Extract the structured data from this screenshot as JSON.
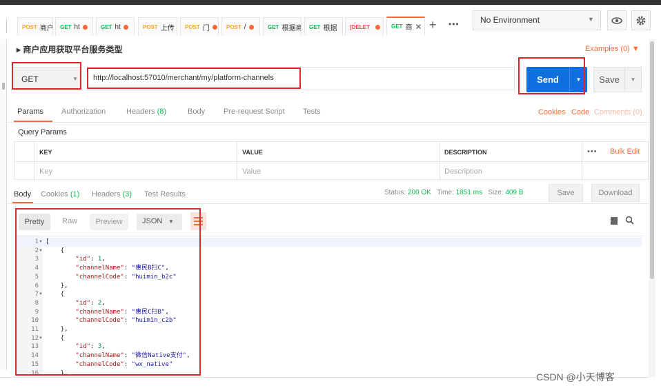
{
  "tabs": [
    {
      "method": "POST",
      "label": "商户",
      "dot": false
    },
    {
      "method": "GET",
      "label": "ht",
      "dot": true
    },
    {
      "method": "GET",
      "label": "ht",
      "dot": true
    },
    {
      "method": "POST",
      "label": "上传",
      "dot": false
    },
    {
      "method": "POST",
      "label": "门",
      "dot": true
    },
    {
      "method": "POST",
      "label": "/",
      "dot": true
    },
    {
      "method": "GET",
      "label": "根据商",
      "dot": false
    },
    {
      "method": "GET",
      "label": "根据",
      "dot": false
    },
    {
      "method": "[DELET",
      "label": "",
      "dot": true
    },
    {
      "method": "GET",
      "label": "商",
      "dot": false,
      "active": true
    }
  ],
  "tab_add": "+",
  "tab_more": "•••",
  "environment": {
    "selected": "No Environment",
    "caret": "▼",
    "eye_icon": "eye-icon",
    "gear_icon": "gear-icon"
  },
  "request": {
    "title": "▸ 商户应用获取平台服务类型",
    "examples": "Examples (0)  ▼",
    "method": "GET",
    "url": "http://localhost:57010/merchant/my/platform-channels",
    "send_label": "Send",
    "save_label": "Save"
  },
  "request_tabs": {
    "params": "Params",
    "authorization": "Authorization",
    "headers": "Headers",
    "headers_count": "(8)",
    "body": "Body",
    "prerequest": "Pre-request Script",
    "tests": "Tests",
    "cookies": "Cookies",
    "code": "Code",
    "comments": "Comments (0)"
  },
  "query_params": {
    "title": "Query Params",
    "headers": {
      "key": "KEY",
      "value": "VALUE",
      "description": "DESCRIPTION"
    },
    "placeholders": {
      "key": "Key",
      "value": "Value",
      "description": "Description"
    },
    "more": "•••",
    "bulk_edit": "Bulk Edit"
  },
  "response_tabs": {
    "body": "Body",
    "cookies": "Cookies",
    "cookies_count": "(1)",
    "headers": "Headers",
    "headers_count": "(3)",
    "test_results": "Test Results"
  },
  "response_meta": {
    "status_label": "Status:",
    "status_value": "200 OK",
    "time_label": "Time:",
    "time_value": "1851 ms",
    "size_label": "Size:",
    "size_value": "409 B",
    "save": "Save",
    "download": "Download"
  },
  "body_toolbar": {
    "pretty": "Pretty",
    "raw": "Raw",
    "preview": "Preview",
    "format": "JSON"
  },
  "code_lines": [
    {
      "n": "1",
      "fold": true,
      "text": "["
    },
    {
      "n": "2",
      "fold": true,
      "text": "    {"
    },
    {
      "n": "3",
      "fold": false,
      "key": "\"id\"",
      "sep": ": ",
      "val": "1",
      "type": "num",
      "tail": ","
    },
    {
      "n": "4",
      "fold": false,
      "key": "\"channelName\"",
      "sep": ": ",
      "val": "\"惠民B扫C\"",
      "type": "str",
      "tail": ","
    },
    {
      "n": "5",
      "fold": false,
      "key": "\"channelCode\"",
      "sep": ": ",
      "val": "\"huimin_b2c\"",
      "type": "str",
      "tail": ""
    },
    {
      "n": "6",
      "fold": false,
      "text": "    },"
    },
    {
      "n": "7",
      "fold": true,
      "text": "    {"
    },
    {
      "n": "8",
      "fold": false,
      "key": "\"id\"",
      "sep": ": ",
      "val": "2",
      "type": "num",
      "tail": ","
    },
    {
      "n": "9",
      "fold": false,
      "key": "\"channelName\"",
      "sep": ": ",
      "val": "\"惠民C扫B\"",
      "type": "str",
      "tail": ","
    },
    {
      "n": "10",
      "fold": false,
      "key": "\"channelCode\"",
      "sep": ": ",
      "val": "\"huimin_c2b\"",
      "type": "str",
      "tail": ""
    },
    {
      "n": "11",
      "fold": false,
      "text": "    },"
    },
    {
      "n": "12",
      "fold": true,
      "text": "    {"
    },
    {
      "n": "13",
      "fold": false,
      "key": "\"id\"",
      "sep": ": ",
      "val": "3",
      "type": "num",
      "tail": ","
    },
    {
      "n": "14",
      "fold": false,
      "key": "\"channelName\"",
      "sep": ": ",
      "val": "\"微信Native支付\"",
      "type": "str",
      "tail": ","
    },
    {
      "n": "15",
      "fold": false,
      "key": "\"channelCode\"",
      "sep": ": ",
      "val": "\"wx_native\"",
      "type": "str",
      "tail": ""
    },
    {
      "n": "16",
      "fold": false,
      "text": "    },"
    }
  ],
  "watermark": "CSDN @小天博客",
  "colors": {
    "accent": "#f26b3a",
    "send": "#1070e0",
    "ok": "#0cbb52",
    "highlight": "#e0262b"
  }
}
